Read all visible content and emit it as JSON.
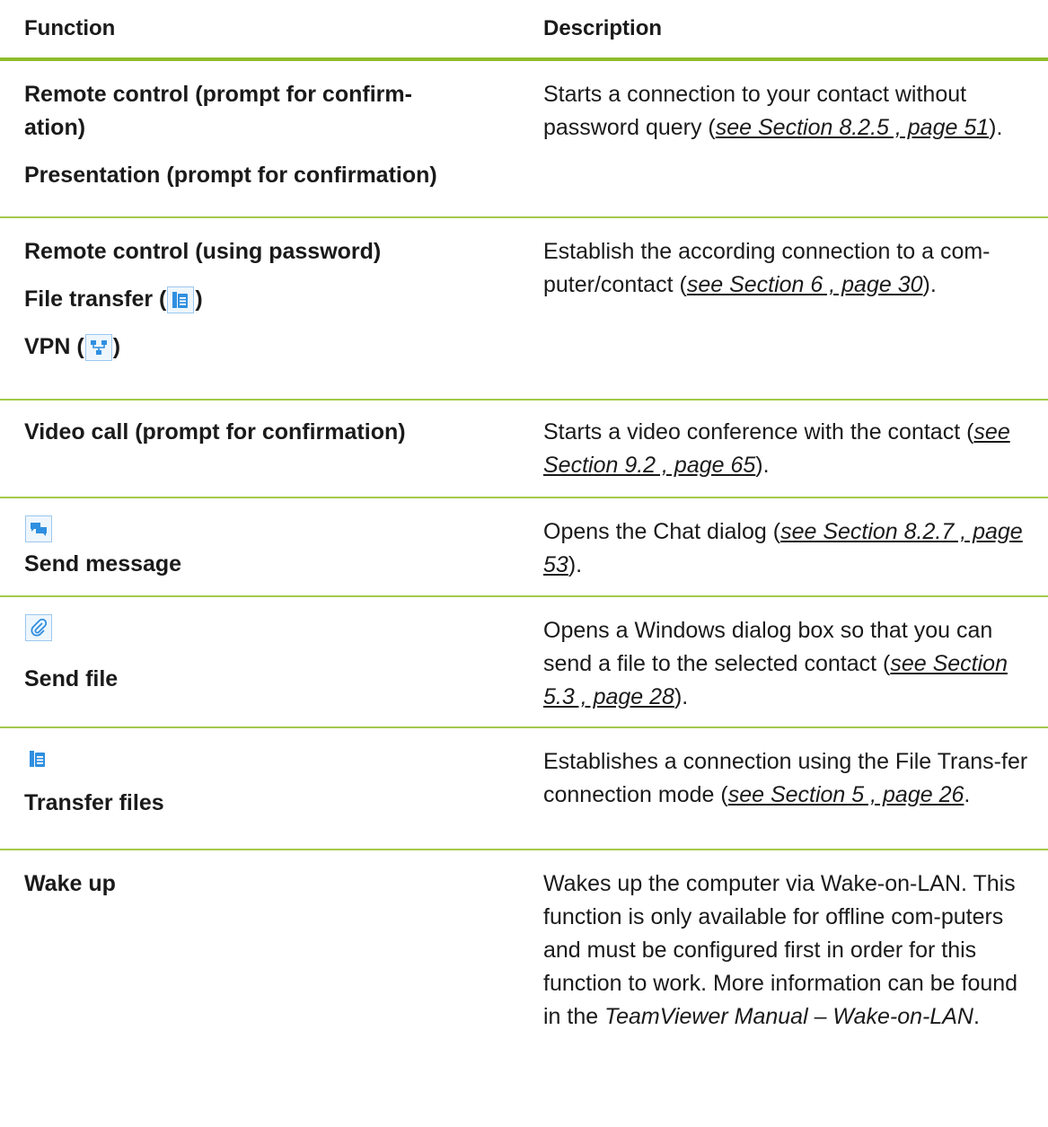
{
  "header": {
    "function": "Function",
    "description": "Description"
  },
  "rows": [
    {
      "functions": [
        "Remote control (prompt for confirm-",
        "ation)",
        "Presentation (prompt for confirmation)"
      ],
      "desc_pre": "Starts a connection to your contact without password query (",
      "desc_ref": "see Section 8.2.5 , page 51",
      "desc_post": ")."
    },
    {
      "functions": [
        "Remote control (using password)",
        "File transfer (",
        ")",
        "VPN (",
        ")"
      ],
      "desc_pre": "Establish the according connection to a com-puter/contact (",
      "desc_ref": "see Section 6 , page 30",
      "desc_post": ")."
    },
    {
      "functions": [
        "Video call (prompt for confirmation)"
      ],
      "desc_pre": "Starts a video conference with the contact (",
      "desc_ref": "see Section 9.2 , page 65",
      "desc_post": ")."
    },
    {
      "icon": "chat-icon",
      "functions": [
        "Send message"
      ],
      "desc_pre": "Opens the Chat dialog (",
      "desc_ref": "see Section 8.2.7 , page 53",
      "desc_post": ")."
    },
    {
      "icon": "paperclip-icon",
      "functions": [
        "Send file"
      ],
      "desc_pre": "Opens a Windows dialog box so that you can send a file to the selected contact (",
      "desc_ref": "see Section 5.3 , page 28",
      "desc_post": ")."
    },
    {
      "icon": "file-transfer-icon",
      "functions": [
        "Transfer files"
      ],
      "desc_pre": "Establishes a connection using the File Trans-fer connection mode (",
      "desc_ref": "see Section 5 , page 26",
      "desc_post": "."
    },
    {
      "functions": [
        "Wake up"
      ],
      "desc_pre": "Wakes up the computer via Wake-on-LAN. This function is only available for offline com-puters and must be configured first in order for this function to work. More information can be found in the ",
      "desc_italic": "TeamViewer Manual – Wake-on-LAN",
      "desc_post": "."
    }
  ],
  "colors": {
    "accent": "#8fbd2a",
    "icon_blue": "#2f8fe0"
  }
}
